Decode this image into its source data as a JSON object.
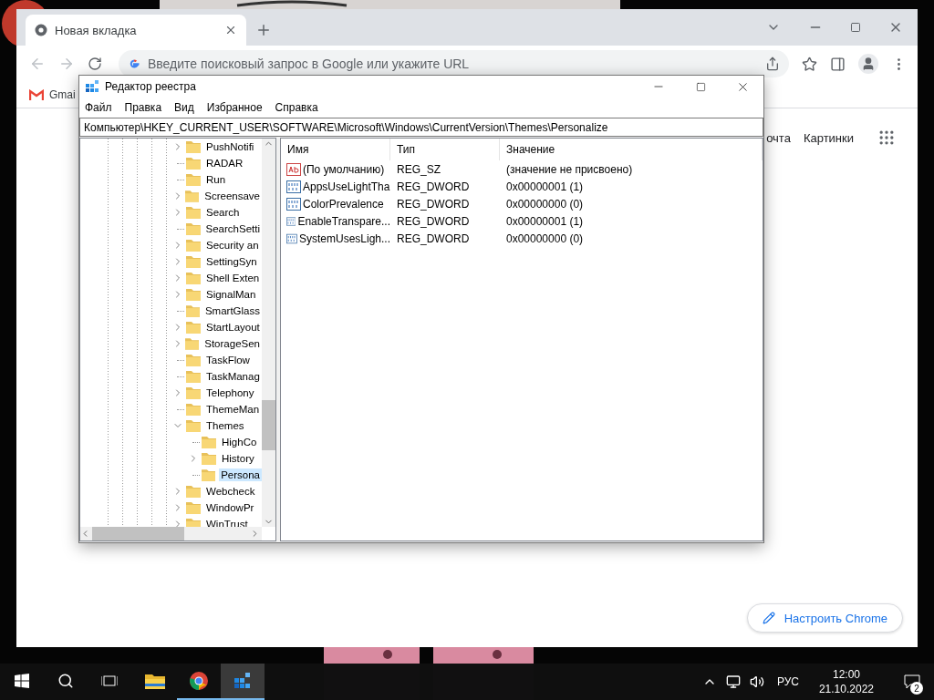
{
  "browser": {
    "tabs": [
      {
        "title": "Новая вкладка",
        "selected": true
      }
    ],
    "address_bar": {
      "placeholder": "Введите поисковый запрос в Google или укажите URL"
    },
    "bookmarks": [
      {
        "label": "Gmai"
      }
    ],
    "header_links": [
      "очта",
      "Картинки"
    ],
    "customize_button": "Настроить Chrome"
  },
  "regedit": {
    "title": "Редактор реестра",
    "menu": [
      "Файл",
      "Правка",
      "Вид",
      "Избранное",
      "Справка"
    ],
    "address": "Компьютер\\HKEY_CURRENT_USER\\SOFTWARE\\Microsoft\\Windows\\CurrentVersion\\Themes\\Personalize",
    "tree": [
      {
        "label": "PushNotifi",
        "expandable": true,
        "expanded": false,
        "selected": false
      },
      {
        "label": "RADAR",
        "expandable": false,
        "expanded": false,
        "selected": false
      },
      {
        "label": "Run",
        "expandable": false,
        "expanded": false,
        "selected": false
      },
      {
        "label": "Screensave",
        "expandable": true,
        "expanded": false,
        "selected": false
      },
      {
        "label": "Search",
        "expandable": true,
        "expanded": false,
        "selected": false
      },
      {
        "label": "SearchSetti",
        "expandable": false,
        "expanded": false,
        "selected": false
      },
      {
        "label": "Security an",
        "expandable": true,
        "expanded": false,
        "selected": false
      },
      {
        "label": "SettingSyn",
        "expandable": true,
        "expanded": false,
        "selected": false
      },
      {
        "label": "Shell Exten",
        "expandable": true,
        "expanded": false,
        "selected": false
      },
      {
        "label": "SignalMan",
        "expandable": true,
        "expanded": false,
        "selected": false
      },
      {
        "label": "SmartGlass",
        "expandable": false,
        "expanded": false,
        "selected": false
      },
      {
        "label": "StartLayout",
        "expandable": true,
        "expanded": false,
        "selected": false
      },
      {
        "label": "StorageSen",
        "expandable": true,
        "expanded": false,
        "selected": false
      },
      {
        "label": "TaskFlow",
        "expandable": false,
        "expanded": false,
        "selected": false
      },
      {
        "label": "TaskManag",
        "expandable": false,
        "expanded": false,
        "selected": false
      },
      {
        "label": "Telephony",
        "expandable": true,
        "expanded": false,
        "selected": false
      },
      {
        "label": "ThemeMan",
        "expandable": false,
        "expanded": false,
        "selected": false
      },
      {
        "label": "Themes",
        "expandable": true,
        "expanded": true,
        "selected": false,
        "children": [
          {
            "label": "HighCo",
            "expandable": false,
            "expanded": false,
            "selected": false
          },
          {
            "label": "History",
            "expandable": true,
            "expanded": false,
            "selected": false
          },
          {
            "label": "Persona",
            "expandable": false,
            "expanded": false,
            "selected": true
          }
        ]
      },
      {
        "label": "Webcheck",
        "expandable": true,
        "expanded": false,
        "selected": false
      },
      {
        "label": "WindowPr",
        "expandable": true,
        "expanded": false,
        "selected": false
      },
      {
        "label": "WinTrust",
        "expandable": true,
        "expanded": false,
        "selected": false
      }
    ],
    "columns": [
      "Имя",
      "Тип",
      "Значение"
    ],
    "rows": [
      {
        "kind": "string",
        "name": "(По умолчанию)",
        "type": "REG_SZ",
        "value": "(значение не присвоено)"
      },
      {
        "kind": "dword",
        "name": "AppsUseLightTha",
        "type": "REG_DWORD",
        "value": "0x00000001 (1)"
      },
      {
        "kind": "dword",
        "name": "ColorPrevalence",
        "type": "REG_DWORD",
        "value": "0x00000000 (0)"
      },
      {
        "kind": "dword",
        "name": "EnableTranspare...",
        "type": "REG_DWORD",
        "value": "0x00000001 (1)"
      },
      {
        "kind": "dword",
        "name": "SystemUsesLigh...",
        "type": "REG_DWORD",
        "value": "0x00000000 (0)"
      }
    ]
  },
  "taskbar": {
    "apps": [
      {
        "kind": "explorer",
        "running": false,
        "active": false
      },
      {
        "kind": "chrome",
        "running": true,
        "active": false
      },
      {
        "kind": "regedit",
        "running": true,
        "active": true
      }
    ],
    "tray": {
      "language": "РУС",
      "time": "12:00",
      "date": "21.10.2022",
      "notifications": "2"
    }
  }
}
